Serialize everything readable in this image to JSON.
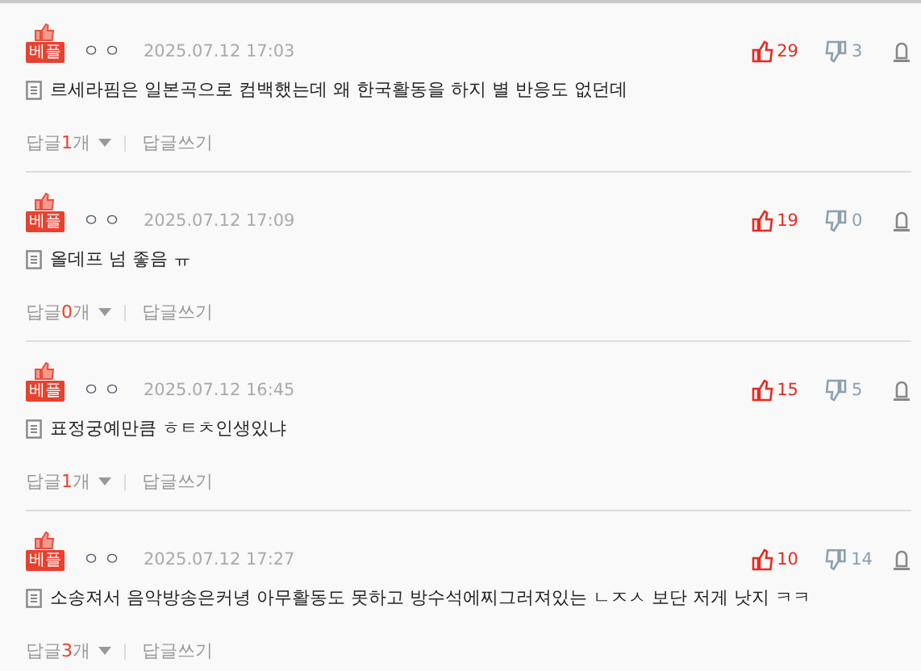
{
  "comments": [
    {
      "badge": "베플",
      "author": "ㅇㅇ",
      "date": "2025.07.12 17:03",
      "likes": "29",
      "dislikes": "3",
      "text": "르세라핌은 일본곡으로 컴백했는데 왜 한국활동을 하지 별 반응도 없던데",
      "reply_prefix": "답글",
      "reply_count": "1",
      "reply_suffix": "개",
      "write_reply": "답글쓰기"
    },
    {
      "badge": "베플",
      "author": "ㅇㅇ",
      "date": "2025.07.12 17:09",
      "likes": "19",
      "dislikes": "0",
      "text": "올데프 넘 좋음 ㅠ",
      "reply_prefix": "답글",
      "reply_count": "0",
      "reply_suffix": "개",
      "write_reply": "답글쓰기"
    },
    {
      "badge": "베플",
      "author": "ㅇㅇ",
      "date": "2025.07.12 16:45",
      "likes": "15",
      "dislikes": "5",
      "text": "표정궁예만큼 ㅎㅌㅊ인생있냐",
      "reply_prefix": "답글",
      "reply_count": "1",
      "reply_suffix": "개",
      "write_reply": "답글쓰기"
    },
    {
      "badge": "베플",
      "author": "ㅇㅇ",
      "date": "2025.07.12 17:27",
      "likes": "10",
      "dislikes": "14",
      "text": "소송져서 음악방송은커녕 아무활동도 못하고 방수석에찌그러져있는 ㄴㅈㅅ 보단 저게 낫지 ㅋㅋ",
      "reply_prefix": "답글",
      "reply_count": "3",
      "reply_suffix": "개",
      "write_reply": "답글쓰기"
    }
  ]
}
